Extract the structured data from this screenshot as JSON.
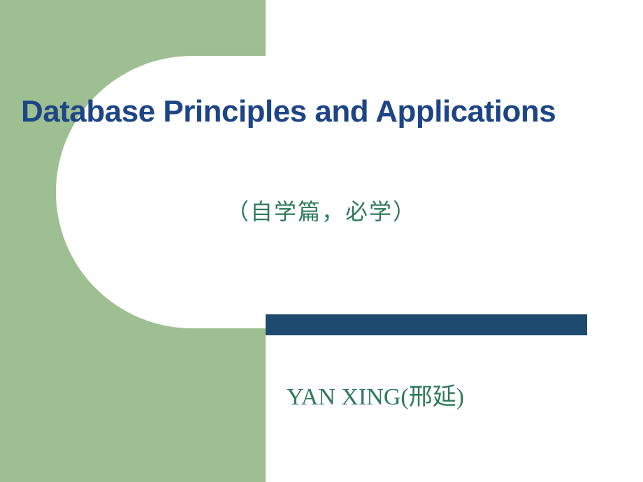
{
  "slide": {
    "title": "Database Principles and Applications",
    "subtitle": "（自学篇，必学）",
    "author": "YAN   XING(邢延)"
  },
  "colors": {
    "leftPanel": "#9ebf91",
    "titleColor": "#1d4586",
    "subtitleColor": "#2d7a5a",
    "barColor": "#1d4a6e"
  }
}
